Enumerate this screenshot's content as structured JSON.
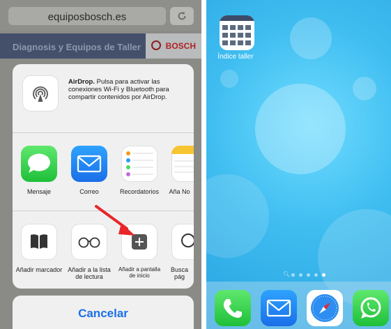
{
  "left_screen": {
    "url": "equiposbosch.es",
    "banner_text": "Diagnosis y Equipos de Taller",
    "brand": "BOSCH",
    "airdrop": {
      "title": "AirDrop.",
      "description": " Pulsa para activar las conexiones Wi-Fi y Bluetooth para compartir contenidos por AirDrop."
    },
    "apps": [
      {
        "label": "Mensaje",
        "icon": "messages-icon"
      },
      {
        "label": "Correo",
        "icon": "mail-icon"
      },
      {
        "label": "Recordatorios",
        "icon": "reminders-icon"
      },
      {
        "label": "Aña No",
        "icon": "notes-icon"
      }
    ],
    "actions": [
      {
        "label": "Añadir marcador",
        "icon": "bookmark-icon"
      },
      {
        "label": "Añadir a la lista de lectura",
        "icon": "reading-list-icon"
      },
      {
        "label": "Añadir a pantalla de inicio",
        "icon": "add-to-home-icon"
      },
      {
        "label": "Busca pág",
        "icon": "search-icon"
      }
    ],
    "cancel_label": "Cancelar",
    "highlight_color": "#e8262a"
  },
  "right_screen": {
    "home_app_label": "Índice taller",
    "dock": [
      {
        "icon": "phone-icon"
      },
      {
        "icon": "mail-icon"
      },
      {
        "icon": "safari-icon"
      },
      {
        "icon": "whatsapp-icon"
      }
    ],
    "page_count": 5,
    "active_page": 5,
    "wallpaper_color": "#3fbdf0"
  }
}
